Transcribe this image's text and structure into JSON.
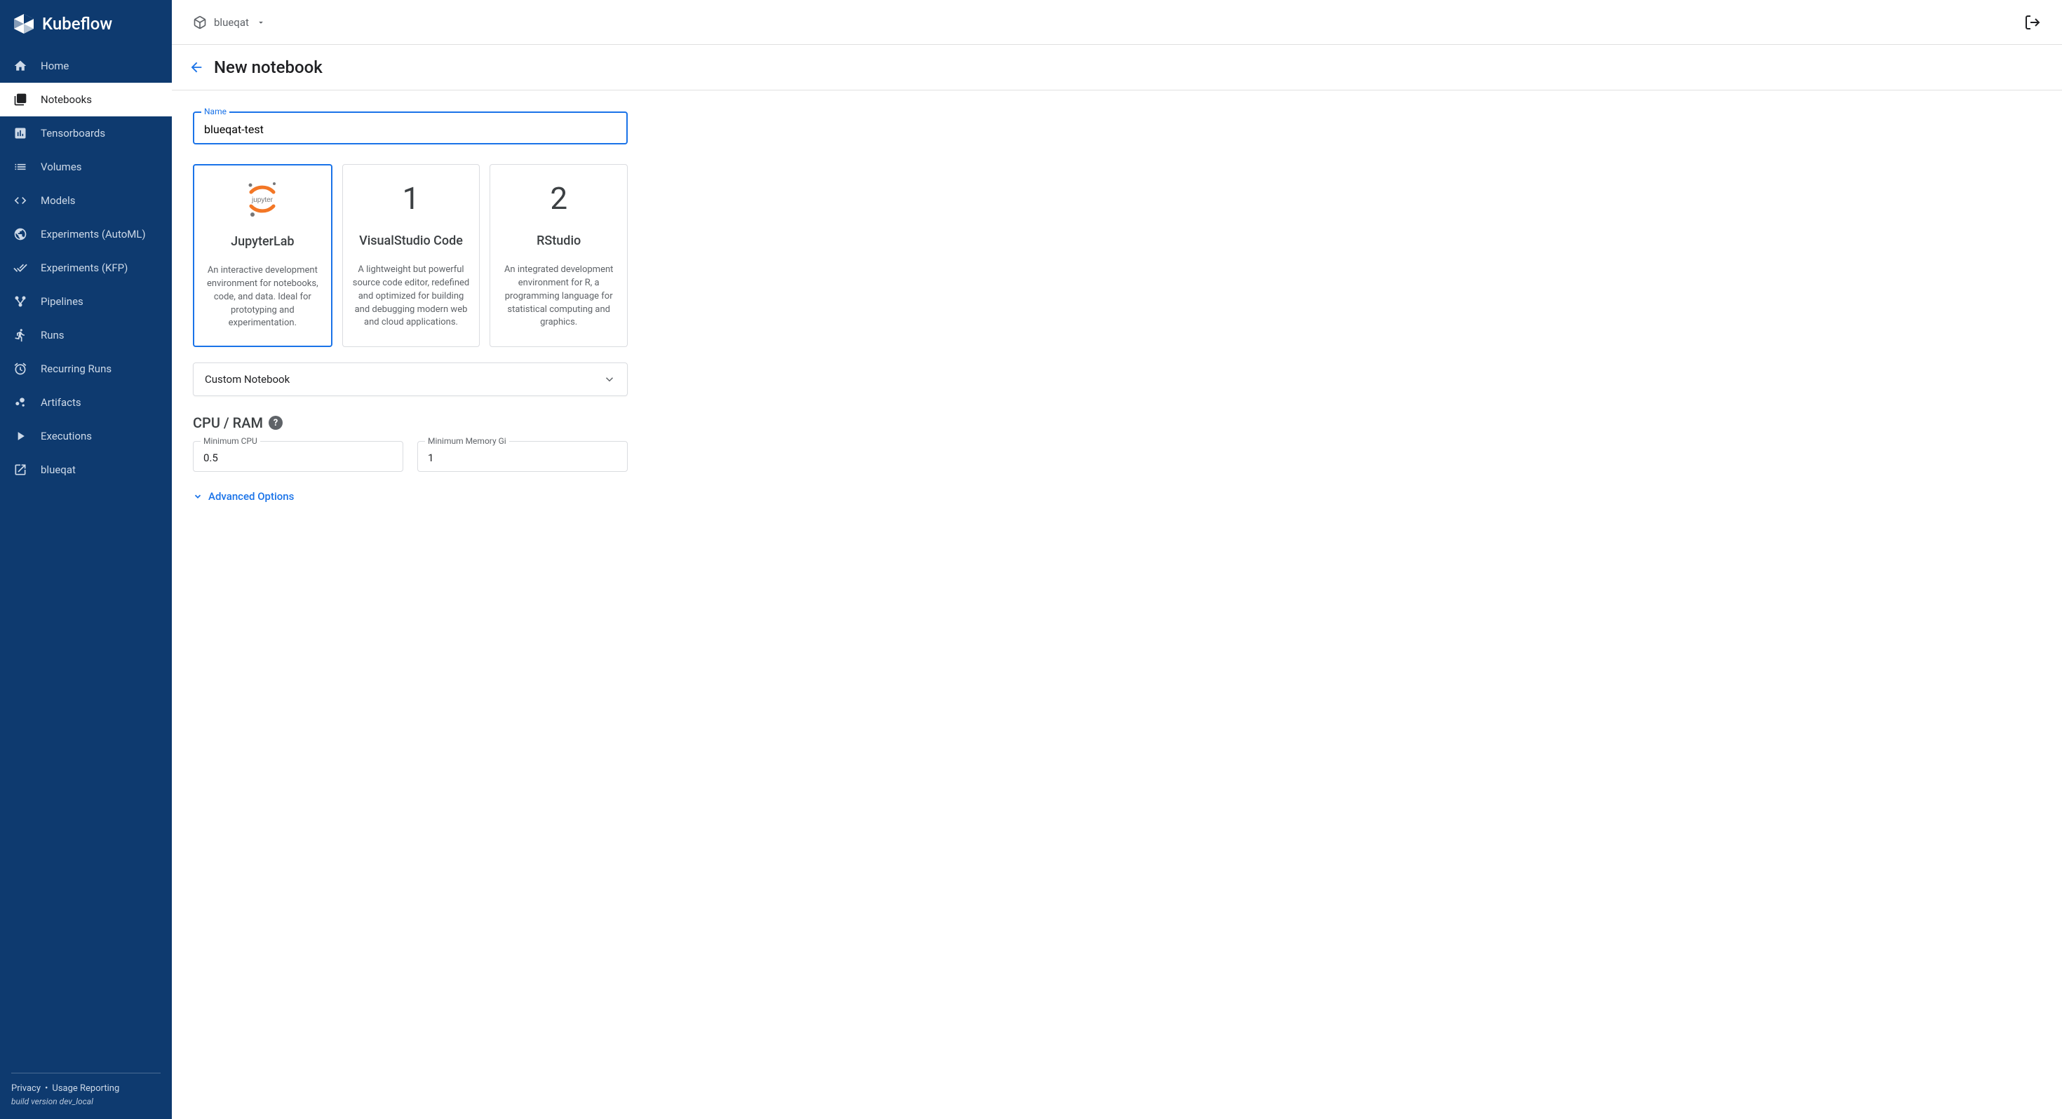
{
  "brand": "Kubeflow",
  "namespace": "blueqat",
  "sidebar": {
    "items": [
      {
        "label": "Home",
        "icon": "home-icon"
      },
      {
        "label": "Notebooks",
        "icon": "notebook-icon",
        "active": true
      },
      {
        "label": "Tensorboards",
        "icon": "chart-icon"
      },
      {
        "label": "Volumes",
        "icon": "list-icon"
      },
      {
        "label": "Models",
        "icon": "code-icon"
      },
      {
        "label": "Experiments (AutoML)",
        "icon": "globe-icon"
      },
      {
        "label": "Experiments (KFP)",
        "icon": "double-check-icon"
      },
      {
        "label": "Pipelines",
        "icon": "share-icon"
      },
      {
        "label": "Runs",
        "icon": "running-icon"
      },
      {
        "label": "Recurring Runs",
        "icon": "clock-icon"
      },
      {
        "label": "Artifacts",
        "icon": "bubble-icon"
      },
      {
        "label": "Executions",
        "icon": "play-icon"
      },
      {
        "label": "blueqat",
        "icon": "external-icon"
      }
    ],
    "footer": {
      "privacy": "Privacy",
      "usage": "Usage Reporting",
      "build": "build version dev_local"
    }
  },
  "page": {
    "title": "New notebook",
    "name_label": "Name",
    "name_value": "blueqat-test",
    "cards": [
      {
        "title": "JupyterLab",
        "desc": "An interactive development environment for notebooks, code, and data. Ideal for prototyping and experimentation.",
        "selected": true,
        "logo": "jupyter"
      },
      {
        "title": "VisualStudio Code",
        "desc": "A lightweight but powerful source code editor, redefined and optimized for building and debugging modern web and cloud applications.",
        "selected": false,
        "logo": "1"
      },
      {
        "title": "RStudio",
        "desc": "An integrated development environment for R, a programming language for statistical computing and graphics.",
        "selected": false,
        "logo": "2"
      }
    ],
    "dropdown_label": "Custom Notebook",
    "cpu_ram_title": "CPU / RAM",
    "min_cpu_label": "Minimum CPU",
    "min_cpu_value": "0.5",
    "min_mem_label": "Minimum Memory Gi",
    "min_mem_value": "1",
    "advanced_options": "Advanced Options"
  }
}
